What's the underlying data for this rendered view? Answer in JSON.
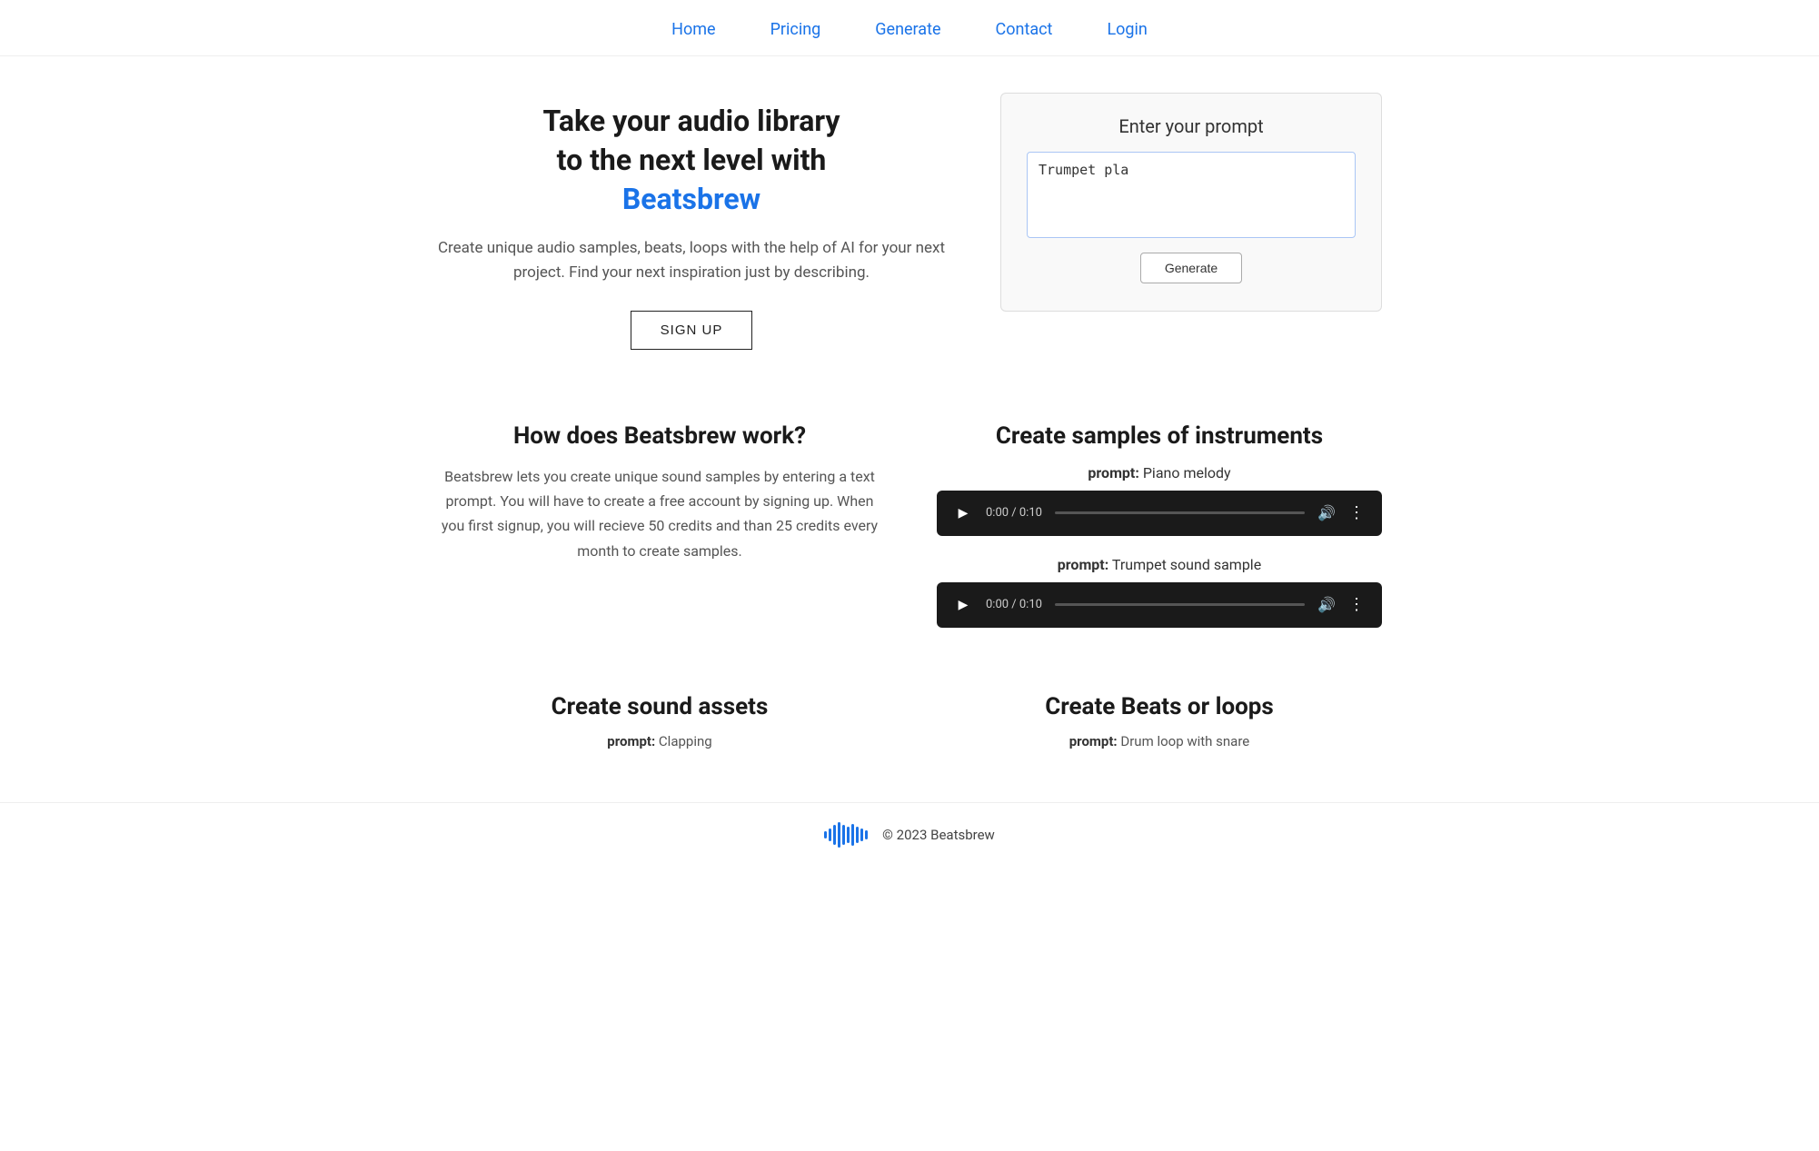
{
  "nav": {
    "items": [
      {
        "label": "Home",
        "href": "#"
      },
      {
        "label": "Pricing",
        "href": "#"
      },
      {
        "label": "Generate",
        "href": "#"
      },
      {
        "label": "Contact",
        "href": "#"
      },
      {
        "label": "Login",
        "href": "#"
      }
    ]
  },
  "hero": {
    "heading_line1": "Take your audio library",
    "heading_line2": "to the next level with",
    "brand": "Beatsbrew",
    "description": "Create unique audio samples, beats, loops with the help of AI for your next project. Find your next inspiration just by describing.",
    "signup_label": "SIGN UP",
    "prompt_box": {
      "title": "Enter your prompt",
      "textarea_value": "Trumpet pla",
      "textarea_placeholder": "Trumpet pla",
      "generate_label": "Generate"
    }
  },
  "how_section": {
    "heading": "How does Beatsbrew work?",
    "description": "Beatsbrew lets you create unique sound samples by entering a text prompt. You will have to create a free account by signing up. When you first signup, you will recieve 50 credits and than 25 credits every month to create samples."
  },
  "instruments_section": {
    "heading": "Create samples of instruments",
    "prompt1_label": "prompt:",
    "prompt1_value": "Piano melody",
    "player1_time": "0:00 / 0:10",
    "prompt2_label": "prompt:",
    "prompt2_value": "Trumpet sound sample",
    "player2_time": "0:00 / 0:10"
  },
  "sound_assets_section": {
    "heading": "Create sound assets",
    "prompt_label": "prompt:",
    "prompt_value": "Clapping"
  },
  "beats_section": {
    "heading": "Create Beats or loops",
    "prompt_label": "prompt:",
    "prompt_value": "Drum loop with snare"
  },
  "footer": {
    "copyright": "© 2023 Beatsbrew"
  }
}
